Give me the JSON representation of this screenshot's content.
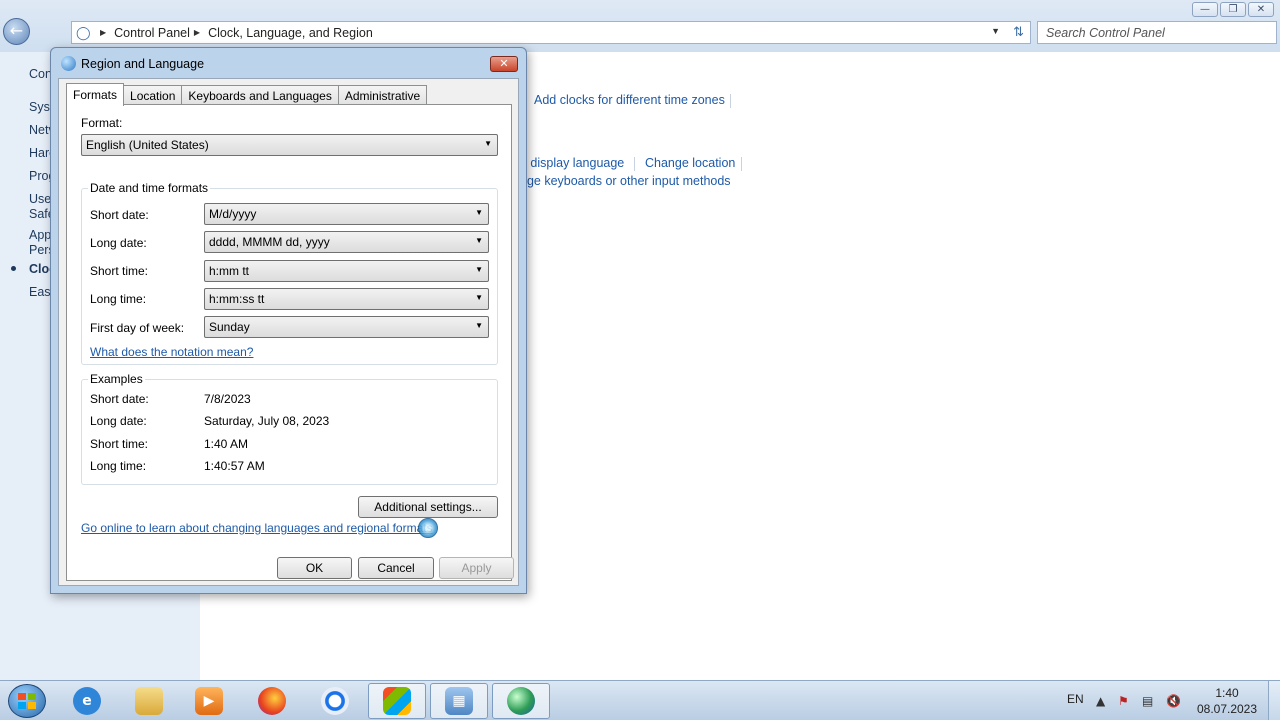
{
  "explorer": {
    "window_controls": {
      "minimize": "—",
      "maximize": "❐",
      "close": "✕"
    },
    "back_icon": "back-arrow-icon",
    "breadcrumb": [
      "Control Panel",
      "Clock, Language, and Region"
    ],
    "search_placeholder": "Search Control Panel",
    "left_pane": [
      "Con",
      "Syst",
      "Netv",
      "Harc",
      "Prog",
      "User",
      "Safe",
      "App",
      "Pers",
      "Cloc",
      "Ease"
    ],
    "main_links": {
      "add_clocks": "Add clocks for different time zones",
      "display_language": "e display language",
      "change_location": "Change location",
      "change_keyboards": "nge keyboards or other input methods"
    }
  },
  "dialog": {
    "title": "Region and Language",
    "close_label": "✕",
    "tabs": [
      "Formats",
      "Location",
      "Keyboards and Languages",
      "Administrative"
    ],
    "format_label": "Format:",
    "format_value": "English (United States)",
    "date_time_group": "Date and time formats",
    "fields": [
      {
        "label": "Short date:",
        "value": "M/d/yyyy"
      },
      {
        "label": "Long date:",
        "value": "dddd, MMMM dd, yyyy"
      },
      {
        "label": "Short time:",
        "value": "h:mm tt"
      },
      {
        "label": "Long time:",
        "value": "h:mm:ss tt"
      },
      {
        "label": "First day of week:",
        "value": "Sunday"
      }
    ],
    "notation_link": "What does the notation mean?",
    "examples_group": "Examples",
    "examples": [
      {
        "label": "Short date:",
        "value": "7/8/2023"
      },
      {
        "label": "Long date:",
        "value": "Saturday, July 08, 2023"
      },
      {
        "label": "Short time:",
        "value": "1:40 AM"
      },
      {
        "label": "Long time:",
        "value": "1:40:57 AM"
      }
    ],
    "additional_settings": "Additional settings...",
    "online_link": "Go online to learn about changing languages and regional formats",
    "ok": "OK",
    "cancel": "Cancel",
    "apply": "Apply"
  },
  "taskbar": {
    "apps": [
      "internet-explorer",
      "file-explorer",
      "media-player",
      "firefox",
      "chrome",
      "windows-flag",
      "control-panel",
      "region-language"
    ],
    "language": "EN",
    "time": "1:40",
    "date": "08.07.2023"
  }
}
